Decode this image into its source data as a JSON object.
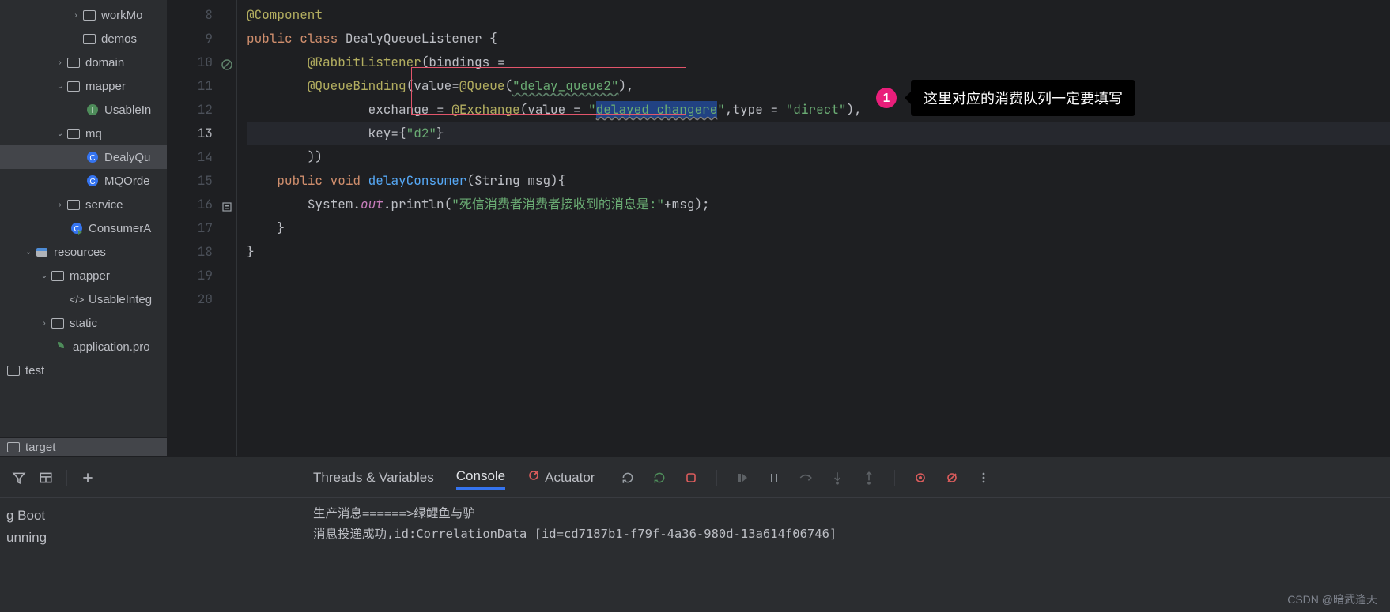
{
  "sidebar": {
    "items": [
      {
        "label": "workMo",
        "icon": "folder",
        "indent": 4,
        "arrow": "right"
      },
      {
        "label": "demos",
        "icon": "folder",
        "indent": 4,
        "arrow": ""
      },
      {
        "label": "domain",
        "icon": "folder",
        "indent": 3,
        "arrow": "right"
      },
      {
        "label": "mapper",
        "icon": "folder",
        "indent": 3,
        "arrow": "down"
      },
      {
        "label": "UsableIn",
        "icon": "interface",
        "indent": 5,
        "arrow": ""
      },
      {
        "label": "mq",
        "icon": "folder",
        "indent": 3,
        "arrow": "down"
      },
      {
        "label": "DealyQu",
        "icon": "class",
        "indent": 5,
        "arrow": "",
        "selected": true
      },
      {
        "label": "MQOrde",
        "icon": "class",
        "indent": 5,
        "arrow": ""
      },
      {
        "label": "service",
        "icon": "folder",
        "indent": 3,
        "arrow": "right"
      },
      {
        "label": "ConsumerA",
        "icon": "class-run",
        "indent": 4,
        "arrow": ""
      },
      {
        "label": "resources",
        "icon": "resources",
        "indent": 1,
        "arrow": "down"
      },
      {
        "label": "mapper",
        "icon": "folder-closed",
        "indent": 2,
        "arrow": "down"
      },
      {
        "label": "UsableInteg",
        "icon": "xml",
        "indent": 4,
        "arrow": ""
      },
      {
        "label": "static",
        "icon": "folder-closed",
        "indent": 2,
        "arrow": "right"
      },
      {
        "label": "application.pro",
        "icon": "leaf",
        "indent": 3,
        "arrow": ""
      },
      {
        "label": "test",
        "icon": "folder-closed",
        "indent": 0,
        "arrow": ""
      }
    ],
    "bottom": "target"
  },
  "gutter_lines": [
    "8",
    "9",
    "10",
    "11",
    "12",
    "13",
    "14",
    "15",
    "16",
    "17",
    "18",
    "19",
    "20"
  ],
  "current_line_index": 5,
  "code": {
    "l8": {
      "anno": "@Component"
    },
    "l9": {
      "kw1": "public",
      "kw2": "class",
      "cls": "DealyQueueListener",
      "brace": "{"
    },
    "l10": {
      "anno": "@RabbitListener",
      "p1": "(bindings ="
    },
    "l11": {
      "anno": "@QueueBinding",
      "p1": "(value=",
      "anno2": "@Queue",
      "p2": "(",
      "str": "\"delay_queue2\"",
      "p3": "),"
    },
    "l12": {
      "p1": "exchange = ",
      "anno": "@Exchange",
      "p2": "(value = ",
      "str": "\"",
      "link": "delayed_changere",
      "strend": "\"",
      "p3": ",type = ",
      "str2": "\"direct\"",
      "p4": "),"
    },
    "l13": {
      "p1": "key={",
      "str": "\"d2\"",
      "p2": "}"
    },
    "l14": {
      "p1": "))"
    },
    "l15": {
      "kw1": "public",
      "kw2": "void",
      "method": "delayConsumer",
      "p1": "(String msg){"
    },
    "l16": {
      "p1": "System.",
      "field": "out",
      "p2": ".println(",
      "str": "\"死信消费者消费者接收到的消息是:\"",
      "p3": "+msg);"
    },
    "l17": {
      "p1": "}"
    },
    "l18": {
      "p1": "}"
    }
  },
  "callout": {
    "num": "1",
    "text": "这里对应的消费队列一定要填写"
  },
  "bottom": {
    "tabs": {
      "t1": "Threads & Variables",
      "t2": "Console",
      "t3": "Actuator"
    },
    "left_items": [
      "g Boot",
      "unning"
    ],
    "console_lines": [
      "生产消息======>绿鲤鱼与驴",
      "消息投递成功,id:CorrelationData [id=cd7187b1-f79f-4a36-980d-13a614f06746]"
    ]
  },
  "watermark": "CSDN @暗武逢天"
}
